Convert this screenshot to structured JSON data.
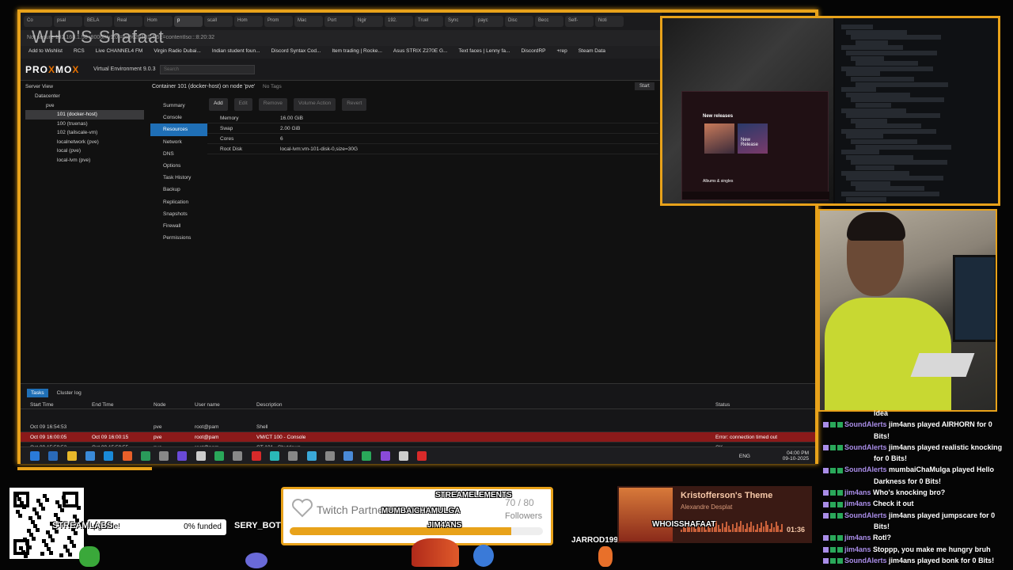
{
  "browser": {
    "tabs": [
      "Co",
      "psal",
      "BELA",
      "Real",
      "Hom",
      "p",
      "scall",
      "Hom",
      "Prom",
      "Mac",
      "Port",
      "Ngir",
      "192.",
      "Truel",
      "Sync",
      "payc",
      "Disc",
      "Becc",
      "Self-",
      "Noti"
    ],
    "address": "Not secure  192.168.1.50 :8006/#v1:0:=lxc%2F101:4:5::=contentIso:::8:20:32",
    "stream_title": "WHO'S Shafaat",
    "bookmarks": [
      "Add to Wishlist",
      "RCS",
      "Live CHANNEL4 FM",
      "Virgin Radio Dubai...",
      "Indian student foun...",
      "Discord Syntax Cod...",
      "Item trading | Rocke...",
      "Asus STRIX Z270E G...",
      "Text faces | Lenny fa...",
      "DiscordRP",
      "+rep",
      "Steam Data"
    ]
  },
  "proxmox": {
    "logo_a": "PRO",
    "logo_x": "X",
    "logo_b": "MO",
    "logo_x2": "X",
    "version": "Virtual Environment 9.0.3",
    "search_placeholder": "Search",
    "server_view": "Server View",
    "tree": [
      {
        "label": "Datacenter",
        "indent": 0
      },
      {
        "label": "pve",
        "indent": 1
      },
      {
        "label": "101 (docker-host)",
        "indent": 2
      },
      {
        "label": "100 (truenas)",
        "indent": 2
      },
      {
        "label": "102 (tailscale-vm)",
        "indent": 2
      },
      {
        "label": "localnetwork (pve)",
        "indent": 2
      },
      {
        "label": "local (pve)",
        "indent": 2
      },
      {
        "label": "local-lvm (pve)",
        "indent": 2
      }
    ],
    "container_title": "Container 101 (docker-host) on node 'pve'",
    "no_tags": "No Tags",
    "start_btn": "Start",
    "menu": [
      "Summary",
      "Console",
      "Resources",
      "Network",
      "DNS",
      "Options",
      "Task History",
      "Backup",
      "Replication",
      "Snapshots",
      "Firewall",
      "Permissions"
    ],
    "toolbar": [
      "Add",
      "Edit",
      "Remove",
      "Volume Action",
      "Revert"
    ],
    "resources": [
      {
        "key": "Memory",
        "value": "16.00 GiB"
      },
      {
        "key": "Swap",
        "value": "2.00 GiB"
      },
      {
        "key": "Cores",
        "value": "6"
      },
      {
        "key": "Root Disk",
        "value": "local-lvm:vm-101-disk-0,size=30G"
      }
    ]
  },
  "tasks": {
    "tabs": [
      "Tasks",
      "Cluster log"
    ],
    "headers": [
      "Start Time",
      "End Time",
      "Node",
      "User name",
      "Description",
      "Status"
    ],
    "rows": [
      {
        "start": "Oct 09 16:54:53",
        "end": "",
        "node": "pve",
        "user": "root@pam",
        "desc": "Shell",
        "status": ""
      },
      {
        "start": "Oct 09 16:00:05",
        "end": "Oct 09 16:00:15",
        "node": "pve",
        "user": "root@pam",
        "desc": "VM/CT 100 - Console",
        "status": "Error: connection timed out"
      },
      {
        "start": "Oct 09 15:59:53",
        "end": "Oct 09 15:59:55",
        "node": "pve",
        "user": "root@pam",
        "desc": "CT 101 - Shutdown",
        "status": "OK"
      }
    ]
  },
  "taskbar": {
    "lang": "ENG",
    "time": "04:00 PM",
    "date": "09-10-2025"
  },
  "music_app": {
    "section": "New releases",
    "card": "New Release",
    "albums_label": "Albums & singles"
  },
  "chat": [
    {
      "user": "",
      "text": "idea"
    },
    {
      "user": "SoundAlerts",
      "text": "jim4ans played AIRHORN for 0"
    },
    {
      "user": "",
      "text": "Bits!"
    },
    {
      "user": "SoundAlerts",
      "text": "jim4ans played realistic knocking"
    },
    {
      "user": "",
      "text": "for 0 Bits!"
    },
    {
      "user": "SoundAlerts",
      "text": "mumbaiChaMulga played Hello"
    },
    {
      "user": "",
      "text": "Darkness for 0 Bits!"
    },
    {
      "user": "jim4ans",
      "text": "Who's knocking bro?"
    },
    {
      "user": "jim4ans",
      "text": "Check it out"
    },
    {
      "user": "SoundAlerts",
      "text": "jim4ans played jumpscare for 0"
    },
    {
      "user": "",
      "text": "Bits!"
    },
    {
      "user": "jim4ans",
      "text": "Rotl?"
    },
    {
      "user": "jim4ans",
      "text": "Stoppp, you make me hungry bruh"
    },
    {
      "user": "SoundAlerts",
      "text": "jim4ans played bonk for 0 Bits!"
    }
  ],
  "overlay": {
    "streamlabs": "STREAMLABS",
    "goal_label": "pgrade!",
    "goal_funded": "0% funded",
    "sery_bot": "SERY_BOT",
    "partner_text": "Twitch Partner",
    "partner_count": "70 / 80",
    "partner_followers": "Followers",
    "partner_progress": 0.875,
    "nick_streamelements": "STREAMELEMENTS",
    "nick_mumbai": "MUMBAICHAMULGA",
    "nick_jim": "JIM4ANS",
    "nick_jarrod": "JARROD1991",
    "nick_whois": "WHOISSHAFAAT",
    "song_title": "Kristofferson's Theme",
    "song_artist": "Alexandre Desplat",
    "song_time": "01:36"
  }
}
